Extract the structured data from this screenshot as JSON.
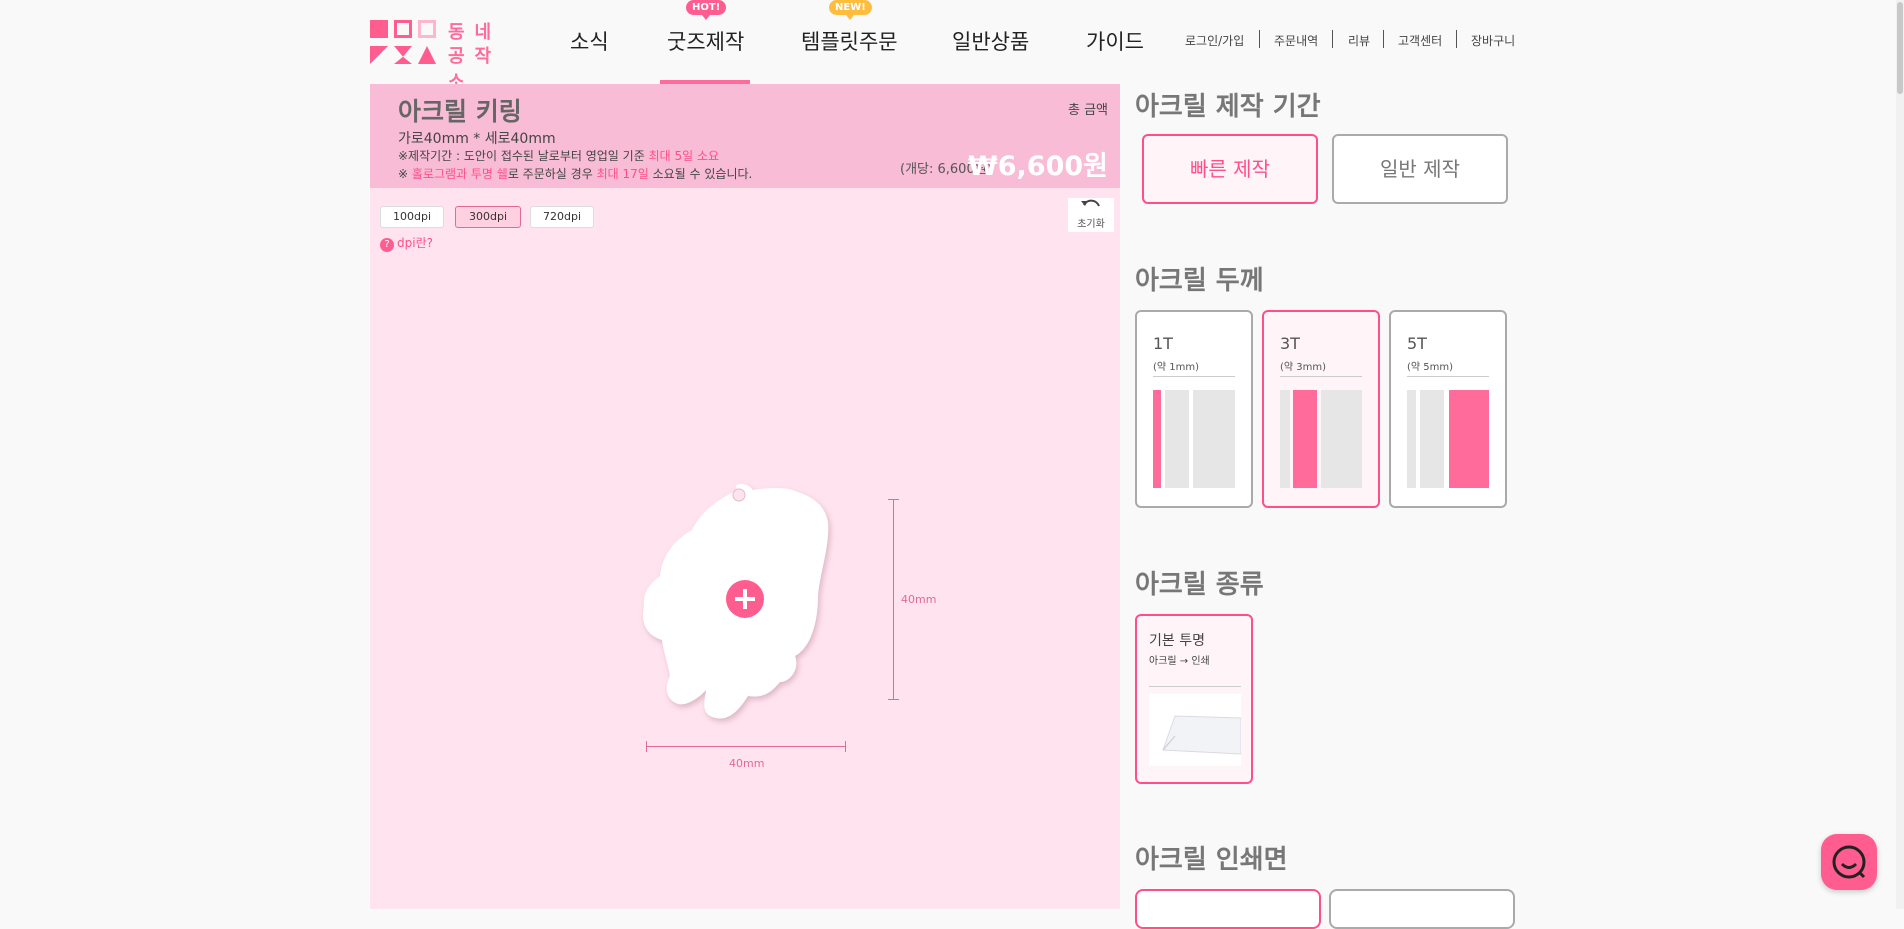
{
  "logo": {
    "line1": "동네",
    "line2": "공작소"
  },
  "nav": [
    {
      "label": "소식"
    },
    {
      "label": "굿즈제작",
      "badge": "HOT!"
    },
    {
      "label": "템플릿주문",
      "badge": "NEW!"
    },
    {
      "label": "일반상품"
    },
    {
      "label": "가이드"
    }
  ],
  "util_links": [
    "로그인/가입",
    "주문내역",
    "리뷰",
    "고객센터",
    "장바구니"
  ],
  "product": {
    "title": "아크릴 키링",
    "size": "가로40mm * 세로40mm",
    "note1_prefix": "※제작기간 : 도안이 접수된 날로부터 영업일 기준 ",
    "note1_highlight": "최대 5일 소요",
    "note2_prefix": "※ ",
    "note2_hl1": "홀로그램과 투명 쉘",
    "note2_mid": "로 주문하실 경우 ",
    "note2_hl2": "최대 17일",
    "note2_suffix": " 소요될 수 있습니다.",
    "total_label": "총 금액",
    "unit_price": "(개당: 6,600원)",
    "total_price": "₩6,600원"
  },
  "editor": {
    "dpi_options": [
      "100dpi",
      "300dpi",
      "720dpi"
    ],
    "dpi_selected": "300dpi",
    "dpi_help": "dpi란?",
    "reset_label": "초기화",
    "width_label": "40mm",
    "height_label": "40mm"
  },
  "options": {
    "period_title": "아크릴 제작 기간",
    "period_buttons": [
      {
        "label": "빠른 제작",
        "active": true
      },
      {
        "label": "일반 제작",
        "active": false
      }
    ],
    "thickness_title": "아크릴 두께",
    "thickness": [
      {
        "name": "1T",
        "sub": "(약 1mm)",
        "active": false
      },
      {
        "name": "3T",
        "sub": "(약 3mm)",
        "active": true
      },
      {
        "name": "5T",
        "sub": "(약 5mm)",
        "active": false
      }
    ],
    "kind_title": "아크릴 종류",
    "kind": {
      "name": "기본 투명",
      "sub": "아크릴 → 인쇄"
    },
    "print_title": "아크릴 인쇄면"
  },
  "colors": {
    "accent": "#ff5d8f",
    "panel": "#ffe3ee",
    "info": "#f8bcd6"
  }
}
